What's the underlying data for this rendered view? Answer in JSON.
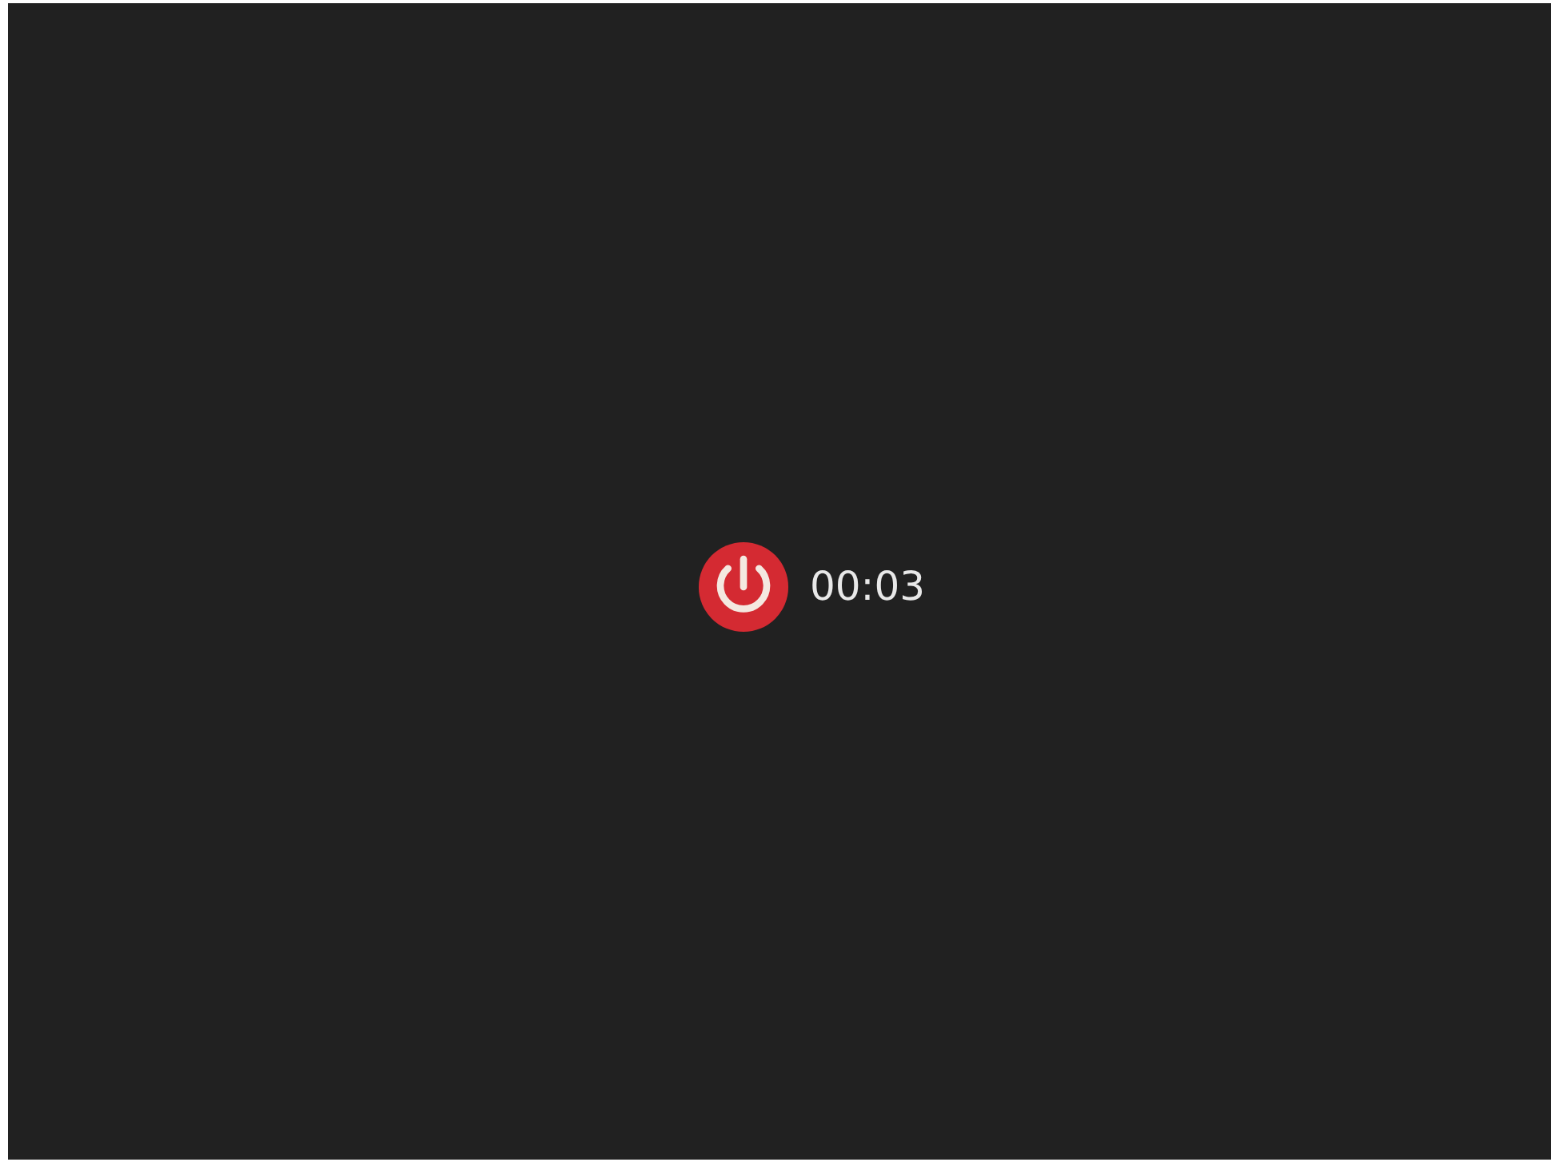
{
  "shutdown": {
    "timer": "00:03"
  }
}
